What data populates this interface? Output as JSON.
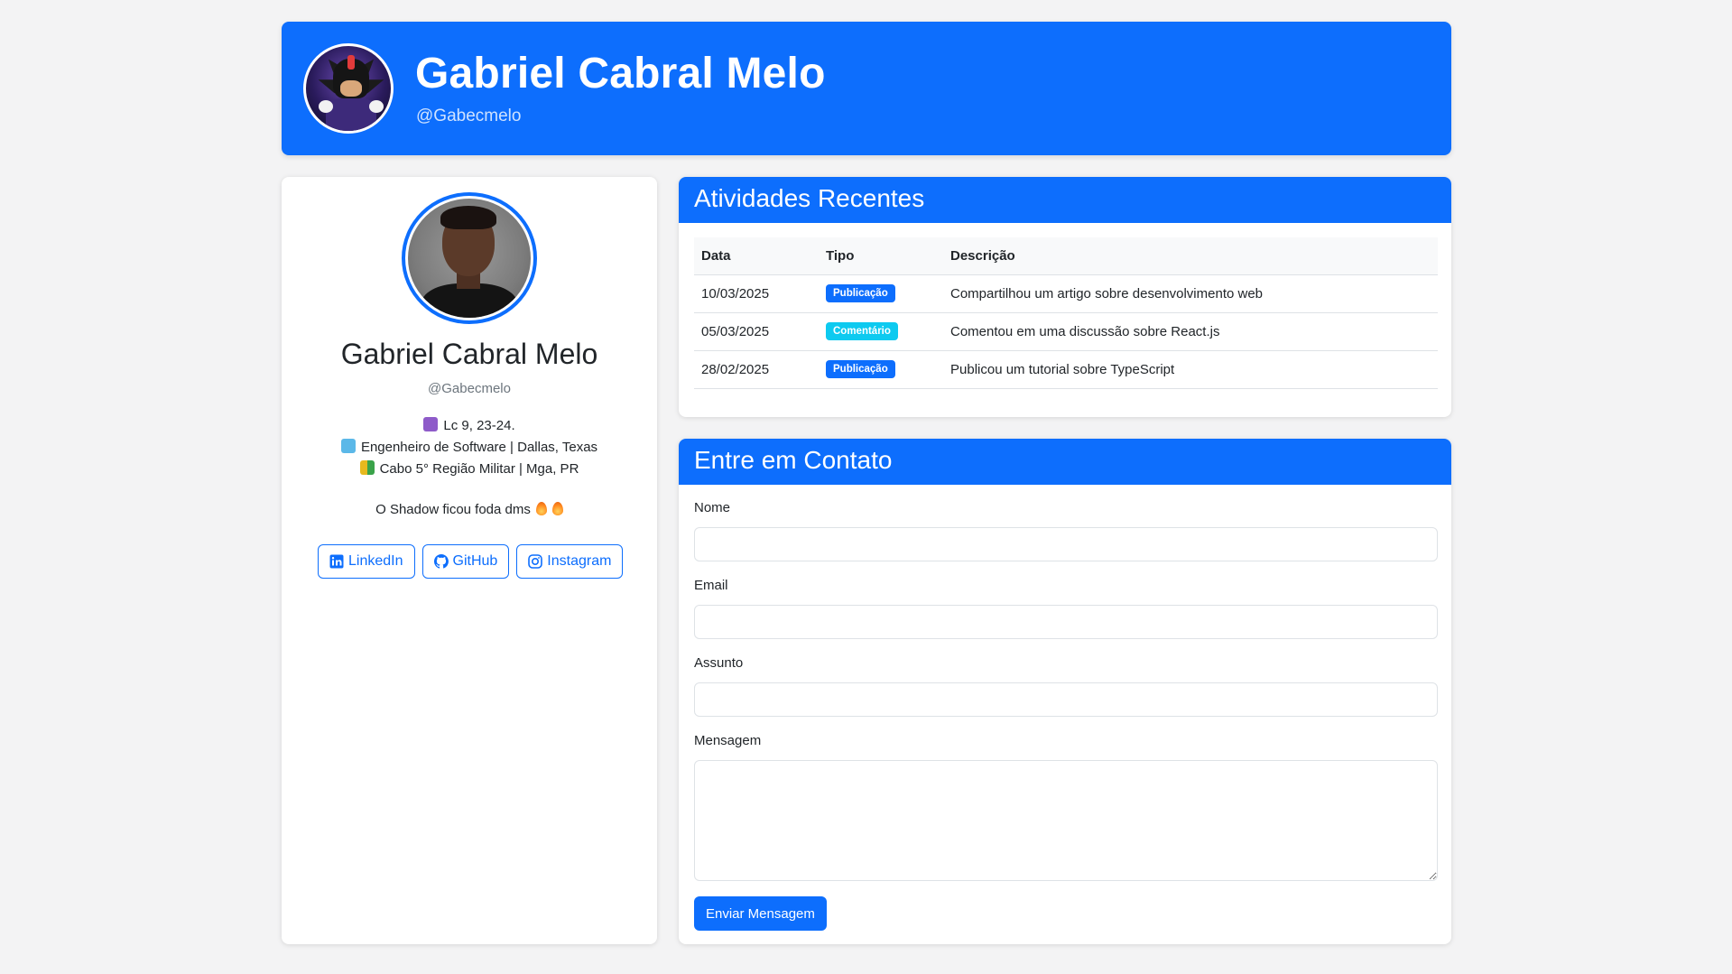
{
  "header": {
    "title": "Gabriel Cabral Melo",
    "handle": "@Gabecmelo",
    "avatar_icon": "shadow-avatar-icon"
  },
  "profile": {
    "name": "Gabriel Cabral Melo",
    "handle": "@Gabecmelo",
    "bio": [
      {
        "emoji": "cross-emoji",
        "color": "#8e5bc9",
        "text": "Lc 9, 23-24."
      },
      {
        "emoji": "laptop-emoji",
        "color": "#5bb8e8",
        "text": "Engenheiro de Software | Dallas, Texas"
      },
      {
        "emoji": "beginner-emoji",
        "color": "#e6b91e",
        "text": "Cabo 5° Região Militar | Mga, PR"
      }
    ],
    "status": "O Shadow ficou foda dms",
    "social": {
      "linkedin": "LinkedIn",
      "github": "GitHub",
      "instagram": "Instagram"
    }
  },
  "activity": {
    "title": "Atividades Recentes",
    "columns": [
      "Data",
      "Tipo",
      "Descrição"
    ],
    "rows": [
      {
        "date": "10/03/2025",
        "type": "Publicação",
        "type_color": "#0d6efd",
        "description": "Compartilhou um artigo sobre desenvolvimento web"
      },
      {
        "date": "05/03/2025",
        "type": "Comentário",
        "type_color": "#0dcaf0",
        "description": "Comentou em uma discussão sobre React.js"
      },
      {
        "date": "28/02/2025",
        "type": "Publicação",
        "type_color": "#0d6efd",
        "description": "Publicou um tutorial sobre TypeScript"
      }
    ]
  },
  "contact": {
    "title": "Entre em Contato",
    "name_label": "Nome",
    "email_label": "Email",
    "subject_label": "Assunto",
    "message_label": "Mensagem",
    "name_value": "",
    "email_value": "",
    "subject_value": "",
    "message_value": "",
    "submit_label": "Enviar Mensagem"
  },
  "colors": {
    "primary": "#0d6efd",
    "info": "#0dcaf0",
    "background": "#f3f3f4"
  }
}
